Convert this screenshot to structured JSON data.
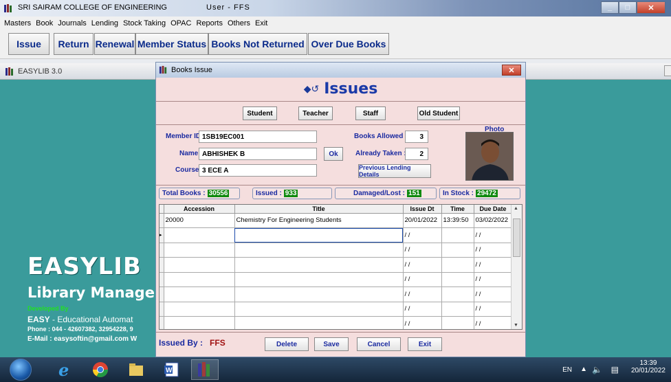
{
  "main_window": {
    "title": "SRI SAIRAM COLLEGE OF ENGINEERING",
    "user_label": "User - FFS"
  },
  "menu": [
    "Masters",
    "Book",
    "Journals",
    "Lending",
    "Stock Taking",
    "OPAC",
    "Reports",
    "Others",
    "Exit"
  ],
  "toolbar": {
    "issue": "Issue",
    "return": "Return",
    "renewal": "Renewal",
    "member_status": "Member Status",
    "books_not_returned": "Books Not Returned",
    "over_due_books": "Over Due Books"
  },
  "easylib_window": {
    "title": "EASYLIB 3.0",
    "brand": "EASYLIB",
    "subtitle": "Library Manage",
    "developed_by": "Developed By",
    "company_prefix": "EASY",
    "company_rest": " - Educational Automat",
    "phone": "Phone : 044 - 42607382, 32954228, 9",
    "email": "E-Mail : easysoftin@gmail.com    W"
  },
  "dialog": {
    "title": "Books Issue",
    "heading": "Issues",
    "member_types": [
      "Student",
      "Teacher",
      "Staff",
      "Old Student"
    ],
    "member_id_label": "Member ID :",
    "member_id": "1SB19EC001",
    "name_label": "Name :",
    "name": "ABHISHEK  B",
    "ok_label": "Ok",
    "course_label": "Course :",
    "course": "3 ECE A",
    "books_allowed_label": "Books Allowed :",
    "books_allowed": "3",
    "already_taken_label": "Already Taken :",
    "already_taken": "2",
    "prev_lending_label": "Previous Lending Details",
    "photo_label": "Photo",
    "stats": {
      "total_books_label": "Total Books :",
      "total_books": "30556",
      "issued_label": "Issued :",
      "issued": "933",
      "damaged_label": "Damaged/Lost :",
      "damaged": "151",
      "in_stock_label": "In Stock :",
      "in_stock": "29472"
    },
    "grid": {
      "columns": [
        "Accession",
        "Title",
        "Issue Dt",
        "Time",
        "Due Date"
      ],
      "rows": [
        [
          "20000",
          "Chemistry For Engineering Students",
          "20/01/2022",
          "13:39:50",
          "03/02/2022"
        ],
        [
          "",
          "",
          "/ /",
          "",
          "/ /"
        ],
        [
          "",
          "",
          "/ /",
          "",
          "/ /"
        ],
        [
          "",
          "",
          "/ /",
          "",
          "/ /"
        ],
        [
          "",
          "",
          "/ /",
          "",
          "/ /"
        ],
        [
          "",
          "",
          "/ /",
          "",
          "/ /"
        ],
        [
          "",
          "",
          "/ /",
          "",
          "/ /"
        ],
        [
          "",
          "",
          "/ /",
          "",
          "/ /"
        ]
      ]
    },
    "issued_by_label": "Issued By :",
    "issued_by": "FFS",
    "actions": [
      "Delete",
      "Save",
      "Cancel",
      "Exit"
    ]
  },
  "taskbar": {
    "lang": "EN",
    "time": "13:39",
    "date": "20/01/2022"
  }
}
